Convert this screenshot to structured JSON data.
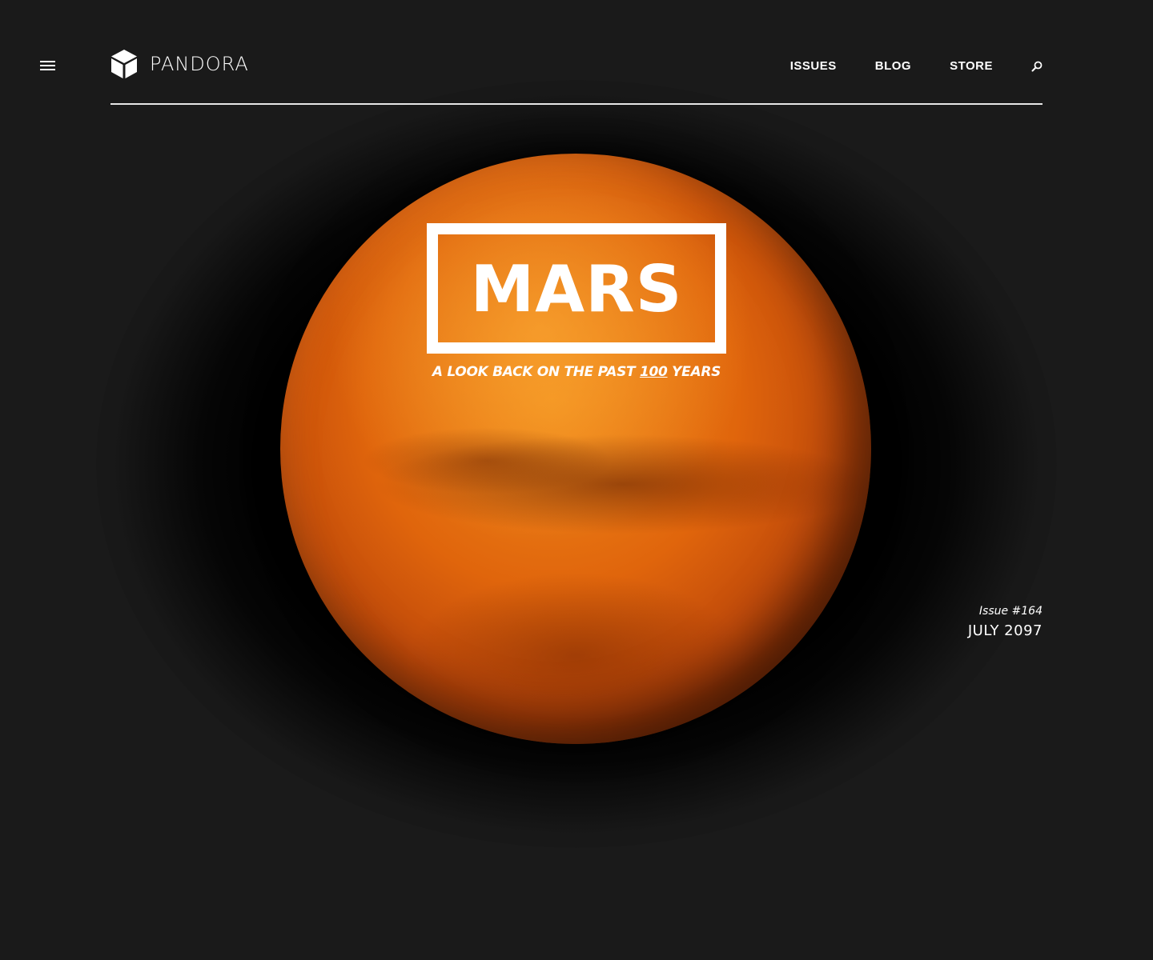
{
  "header": {
    "menu_icon": "hamburger-menu-icon",
    "logo_icon": "cube-icon",
    "logo_text": "PANDORA",
    "nav": [
      {
        "label": "ISSUES"
      },
      {
        "label": "BLOG"
      },
      {
        "label": "STORE"
      }
    ],
    "search_icon": "search-icon"
  },
  "hero": {
    "title": "MARS",
    "subtitle_prefix": "A LOOK BACK ON THE PAST ",
    "subtitle_number": "100",
    "subtitle_suffix": " YEARS"
  },
  "issue": {
    "number": "Issue #164",
    "date": "JULY 2097"
  },
  "colors": {
    "background": "#1a1a1a",
    "planet": "#e0650c",
    "text": "#ffffff"
  }
}
